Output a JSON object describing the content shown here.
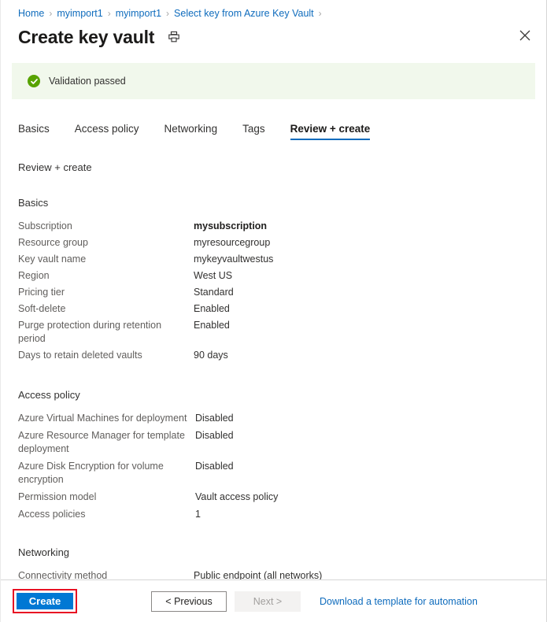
{
  "breadcrumb": {
    "items": [
      {
        "label": "Home"
      },
      {
        "label": "myimport1"
      },
      {
        "label": "myimport1"
      },
      {
        "label": "Select key from Azure Key Vault"
      }
    ],
    "separator": "›"
  },
  "header": {
    "title": "Create key vault",
    "print_icon": "printer-icon",
    "close_icon": "close-icon"
  },
  "validation": {
    "icon": "check-circle-icon",
    "message": "Validation passed",
    "background_color": "#f1f8ec",
    "icon_color": "#57a300"
  },
  "tabs": [
    {
      "label": "Basics",
      "active": false
    },
    {
      "label": "Access policy",
      "active": false
    },
    {
      "label": "Networking",
      "active": false
    },
    {
      "label": "Tags",
      "active": false
    },
    {
      "label": "Review + create",
      "active": true
    }
  ],
  "main": {
    "review_heading": "Review + create",
    "sections": [
      {
        "title": "Basics",
        "rows": [
          {
            "label": "Subscription",
            "value": "mysubscription",
            "strong": true
          },
          {
            "label": "Resource group",
            "value": "myresourcegroup",
            "strong": false
          },
          {
            "label": "Key vault name",
            "value": "mykeyvaultwestus",
            "strong": false
          },
          {
            "label": "Region",
            "value": "West US",
            "strong": false
          },
          {
            "label": "Pricing tier",
            "value": "Standard",
            "strong": false
          },
          {
            "label": "Soft-delete",
            "value": "Enabled",
            "strong": false
          },
          {
            "label": "Purge protection during retention period",
            "value": "Enabled",
            "strong": false
          },
          {
            "label": "Days to retain deleted vaults",
            "value": "90 days",
            "strong": false
          }
        ]
      },
      {
        "title": "Access policy",
        "rows": [
          {
            "label": "Azure Virtual Machines for deployment",
            "value": "Disabled",
            "strong": false
          },
          {
            "label": "Azure Resource Manager for template deployment",
            "value": "Disabled",
            "strong": false
          },
          {
            "label": "Azure Disk Encryption for volume encryption",
            "value": "Disabled",
            "strong": false
          },
          {
            "label": "Permission model",
            "value": "Vault access policy",
            "strong": false
          },
          {
            "label": "Access policies",
            "value": "1",
            "strong": false
          }
        ]
      },
      {
        "title": "Networking",
        "rows": [
          {
            "label": "Connectivity method",
            "value": "Public endpoint (all networks)",
            "strong": false
          }
        ]
      }
    ]
  },
  "footer": {
    "create_label": "Create",
    "create_highlight_color": "#e81123",
    "create_button_color": "#0078d4",
    "previous_label": "< Previous",
    "next_label": "Next >",
    "next_disabled": true,
    "download_label": "Download a template for automation",
    "link_color": "#0f6cbd"
  }
}
